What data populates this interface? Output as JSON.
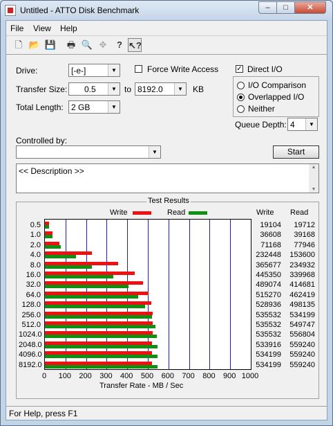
{
  "window": {
    "title": "Untitled - ATTO Disk Benchmark",
    "controls": {
      "minimize": "–",
      "maximize": "□",
      "close": "✕"
    }
  },
  "menu": [
    "File",
    "View",
    "Help"
  ],
  "toolbar_icons": [
    "new-file-icon",
    "open-folder-icon",
    "save-icon",
    "print-icon",
    "print-preview-icon",
    "move-icon",
    "help-icon",
    "context-help-icon"
  ],
  "form": {
    "drive_label": "Drive:",
    "drive_value": "[-e-]",
    "force_write_label": "Force Write Access",
    "force_write_checked": false,
    "direct_io_label": "Direct I/O",
    "direct_io_checked": true,
    "transfer_size_label": "Transfer Size:",
    "transfer_from": "0.5",
    "to_label": "to",
    "transfer_to": "8192.0",
    "kb_label": "KB",
    "total_length_label": "Total Length:",
    "total_length_value": "2 GB",
    "io_comparison_label": "I/O Comparison",
    "overlapped_io_label": "Overlapped I/O",
    "neither_label": "Neither",
    "selected_io_mode": "Overlapped I/O",
    "queue_depth_label": "Queue Depth:",
    "queue_depth_value": "4",
    "controlled_by_label": "Controlled by:",
    "controlled_by_value": "",
    "start_label": "Start",
    "description_text": "<< Description >>"
  },
  "results": {
    "title": "Test Results",
    "legend_write": "Write",
    "legend_read": "Read",
    "col_write": "Write",
    "col_read": "Read"
  },
  "chart_data": {
    "type": "bar",
    "orientation": "horizontal",
    "title": "Test Results",
    "xlabel": "Transfer Rate - MB / Sec",
    "xlim": [
      0,
      1000
    ],
    "xticks": [
      "0",
      "100",
      "200",
      "300",
      "400",
      "500",
      "600",
      "700",
      "800",
      "900",
      "1000"
    ],
    "categories": [
      "0.5",
      "1.0",
      "2.0",
      "4.0",
      "8.0",
      "16.0",
      "32.0",
      "64.0",
      "128.0",
      "256.0",
      "512.0",
      "1024.0",
      "2048.0",
      "4096.0",
      "8192.0"
    ],
    "series": [
      {
        "name": "Write",
        "color": "#ee1111",
        "values_kb": [
          "19104",
          "36608",
          "71168",
          "232448",
          "365677",
          "445350",
          "489074",
          "515270",
          "528936",
          "535532",
          "535532",
          "535532",
          "533916",
          "534199",
          "534199"
        ]
      },
      {
        "name": "Read",
        "color": "#109010",
        "values_kb": [
          "19712",
          "39168",
          "77946",
          "153600",
          "234932",
          "339968",
          "414681",
          "462419",
          "498135",
          "534199",
          "549747",
          "556804",
          "559240",
          "559240",
          "559240"
        ]
      }
    ],
    "grid": true,
    "legend_position": "top"
  },
  "status": {
    "text": "For Help, press F1"
  }
}
